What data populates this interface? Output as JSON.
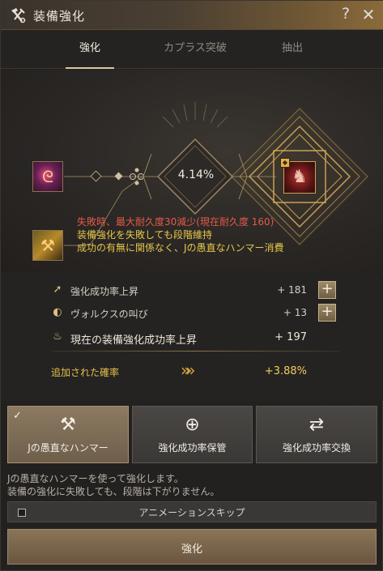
{
  "window": {
    "title": "装備強化",
    "help_label": "?",
    "close_label": "✕",
    "title_icon": "hammer-icon"
  },
  "tabs": [
    {
      "label": "強化",
      "active": true
    },
    {
      "label": "カプラス突破",
      "active": false
    },
    {
      "label": "抽出",
      "active": false
    }
  ],
  "stage": {
    "success_rate": "4.14%",
    "top_item_icon": "crystal-item-icon",
    "bottom_item_icon": "hammer-item-icon",
    "target_item_icon": "armor-item-icon",
    "warnings": [
      {
        "text": "失敗時、最大耐久度30減少(現在耐久度 160)",
        "color": "#e45a4a"
      },
      {
        "text": "装備強化を失敗しても段階維持",
        "color": "#e7c74a"
      },
      {
        "text": "成功の有無に関係なく、Jの愚直なハンマー消費",
        "color": "#e7c74a"
      }
    ]
  },
  "stats": {
    "rows": [
      {
        "label": "強化成功率上昇",
        "value": "+ 181",
        "icon": "up-arrow-icon",
        "has_plus": true
      },
      {
        "label": "ヴォルクスの叫び",
        "value": "+ 13",
        "icon": "vorks-icon",
        "has_plus": true
      },
      {
        "label": "現在の装備強化成功率上昇",
        "value": "+ 197",
        "icon": "flame-icon",
        "has_plus": false
      }
    ],
    "added_label": "追加された確率",
    "added_value": "+3.88%",
    "plus_label": "+"
  },
  "actions": [
    {
      "label": "Jの愚直なハンマー",
      "icon": "hammer-icon",
      "selected": true,
      "check": "✓"
    },
    {
      "label": "強化成功率保管",
      "icon": "download-icon",
      "selected": false
    },
    {
      "label": "強化成功率交換",
      "icon": "swap-icon",
      "selected": false
    }
  ],
  "description": [
    "Jの愚直なハンマーを使って強化します。",
    "装備の強化に失敗しても、段階は下がりません。"
  ],
  "skip": {
    "label": "アニメーションスキップ",
    "checked": false
  },
  "main_button": {
    "label": "強化"
  }
}
